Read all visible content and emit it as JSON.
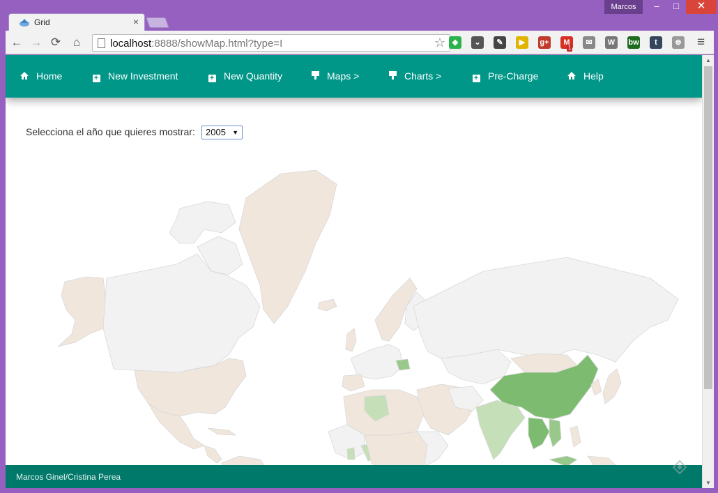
{
  "window": {
    "user": "Marcos",
    "minimize_glyph": "–",
    "maximize_glyph": "□",
    "close_glyph": "✕"
  },
  "tab": {
    "title": "Grid",
    "close_glyph": "×",
    "favicon": "grid-favicon-icon"
  },
  "toolbar": {
    "url_host": "localhost",
    "url_rest": ":8888/showMap.html?type=I",
    "back_glyph": "←",
    "forward_glyph": "→",
    "reload_glyph": "⟳",
    "home_glyph": "⌂",
    "star_glyph": "☆",
    "menu_glyph": "≡",
    "extensions": [
      {
        "name": "feedly-icon",
        "color": "#2bb24c",
        "glyph": "◆"
      },
      {
        "name": "pocket-icon",
        "color": "#555555",
        "glyph": "⌄"
      },
      {
        "name": "evernote-icon",
        "color": "#444444",
        "glyph": "✎"
      },
      {
        "name": "clip-icon",
        "color": "#e0b400",
        "glyph": "▶"
      },
      {
        "name": "google-plus-icon",
        "color": "#c0392b",
        "glyph": "g+"
      },
      {
        "name": "gmail-icon",
        "color": "#d93025",
        "glyph": "M"
      },
      {
        "name": "mail-icon",
        "color": "#888888",
        "glyph": "✉"
      },
      {
        "name": "wikipedia-icon",
        "color": "#777777",
        "glyph": "W"
      },
      {
        "name": "bw-icon",
        "color": "#1f6b1f",
        "glyph": "bw"
      },
      {
        "name": "tumblr-icon",
        "color": "#35465c",
        "glyph": "t"
      },
      {
        "name": "steering-icon",
        "color": "#999999",
        "glyph": "⊛"
      }
    ],
    "gmail_badge": "1"
  },
  "nav": {
    "items": [
      {
        "label": "Home",
        "icon": "home-icon"
      },
      {
        "label": "New Investment",
        "icon": "plus-square-icon"
      },
      {
        "label": "New Quantity",
        "icon": "plus-square-icon"
      },
      {
        "label": "Maps >",
        "icon": "map-marker-icon"
      },
      {
        "label": "Charts >",
        "icon": "map-marker-icon"
      },
      {
        "label": "Pre-Charge",
        "icon": "plus-square-icon"
      },
      {
        "label": "Help",
        "icon": "home-icon"
      }
    ]
  },
  "main": {
    "year_label": "Selecciona el año que quieres mostrar:",
    "year_value": "2005"
  },
  "map": {
    "colors": {
      "no_data": "#f2f2f2",
      "low": "#f0e6dc",
      "light_green": "#c5dfb8",
      "mid_green": "#98c98a",
      "green": "#7dbb70",
      "dark_green": "#109618",
      "ocean": "#ffffff",
      "border": "#d8d8d8"
    }
  },
  "footer": {
    "text": "Marcos Ginel/Cristina Perea"
  },
  "scrollbar": {
    "up_glyph": "▲",
    "down_glyph": "▼"
  }
}
